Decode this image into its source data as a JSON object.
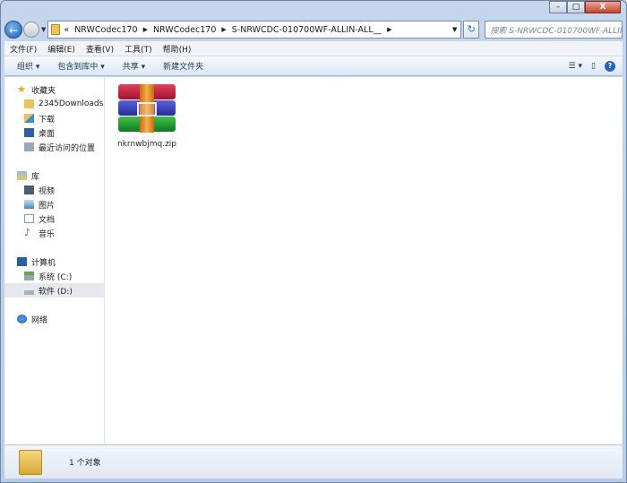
{
  "window": {
    "minimize": "–",
    "maximize": "□",
    "close": "X"
  },
  "address": {
    "breadcrumbs": [
      "NRWCodec170",
      "NRWCodec170",
      "S-NRWCDC-010700WF-ALLIN-ALL__"
    ],
    "overflow": "«",
    "search_placeholder": "搜索 S-NRWCDC-010700WF-ALLIN..."
  },
  "menu": [
    "文件(F)",
    "编辑(E)",
    "查看(V)",
    "工具(T)",
    "帮助(H)"
  ],
  "toolbar": {
    "organize": "组织 ▾",
    "include": "包含到库中 ▾",
    "share": "共享 ▾",
    "new_folder": "新建文件夹",
    "help": "?"
  },
  "sidebar": {
    "favorites": {
      "label": "收藏夹",
      "items": [
        "2345Downloads",
        "下载",
        "桌面",
        "最近访问的位置"
      ]
    },
    "libraries": {
      "label": "库",
      "items": [
        "视频",
        "图片",
        "文档",
        "音乐"
      ]
    },
    "computer": {
      "label": "计算机",
      "items": [
        "系统 (C:)",
        "软件 (D:)"
      ]
    },
    "network": {
      "label": "网络"
    }
  },
  "files": [
    {
      "name": "nkrnwbjmq.zip",
      "icon": "winrar-archive-icon"
    }
  ],
  "status": {
    "count": "1 个对象"
  }
}
